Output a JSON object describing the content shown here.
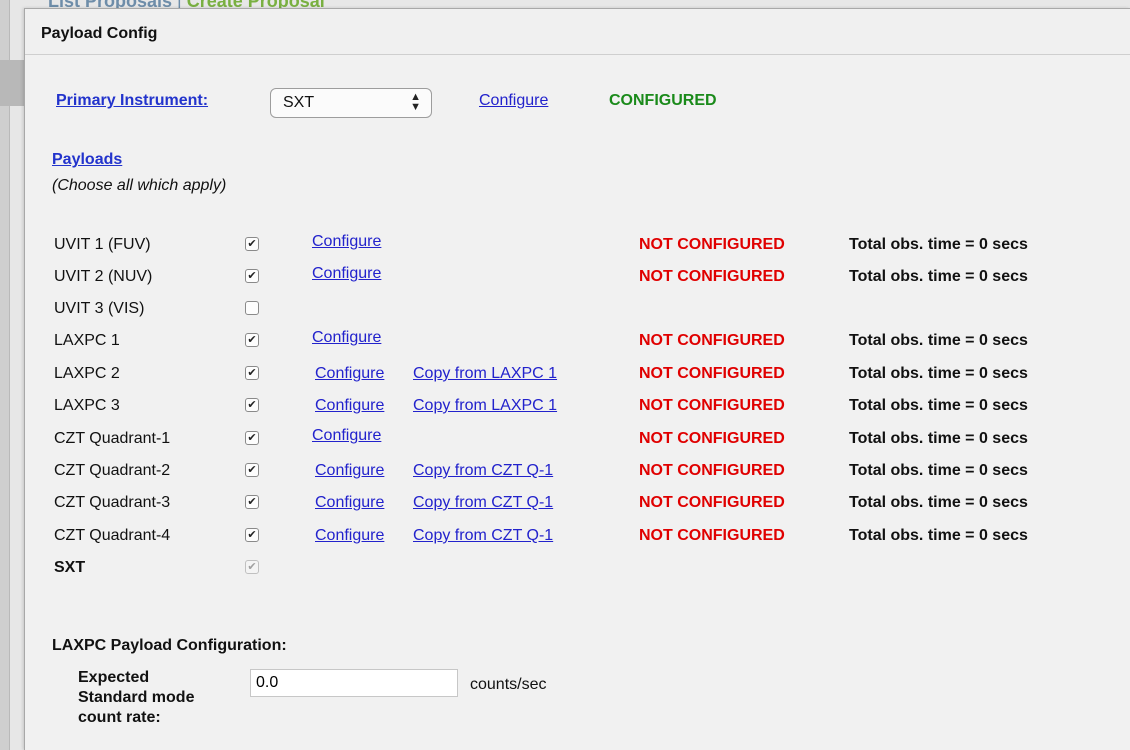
{
  "background": {
    "nav_list_proposals": "List Proposals",
    "nav_separator": "|",
    "nav_create_proposal": "Create Proposal"
  },
  "dialog": {
    "title": "Payload Config"
  },
  "primary": {
    "label": "Primary Instrument:",
    "selected": "SXT",
    "configure": "Configure",
    "status": "CONFIGURED"
  },
  "payloads": {
    "title": "Payloads",
    "hint": "(Choose all which apply)",
    "rows": [
      {
        "name": "UVIT 1 (FUV)",
        "checked": true,
        "configure": "Configure",
        "copy": "",
        "status": "NOT CONFIGURED",
        "total": "Total obs. time = 0 secs"
      },
      {
        "name": "UVIT 2 (NUV)",
        "checked": true,
        "configure": "Configure",
        "copy": "",
        "status": "NOT CONFIGURED",
        "total": "Total obs. time = 0 secs"
      },
      {
        "name": "UVIT 3 (VIS)",
        "checked": false,
        "configure": "",
        "copy": "",
        "status": "",
        "total": ""
      },
      {
        "name": "LAXPC 1",
        "checked": true,
        "configure": "Configure",
        "copy": "",
        "status": "NOT CONFIGURED",
        "total": "Total obs. time = 0 secs"
      },
      {
        "name": "LAXPC 2",
        "checked": true,
        "configure": "Configure",
        "copy": "Copy from LAXPC 1",
        "status": "NOT CONFIGURED",
        "total": "Total obs. time = 0 secs"
      },
      {
        "name": "LAXPC 3",
        "checked": true,
        "configure": "Configure",
        "copy": "Copy from LAXPC 1",
        "status": "NOT CONFIGURED",
        "total": "Total obs. time = 0 secs"
      },
      {
        "name": "CZT Quadrant-1",
        "checked": true,
        "configure": "Configure",
        "copy": "",
        "status": "NOT CONFIGURED",
        "total": "Total obs. time = 0 secs"
      },
      {
        "name": "CZT Quadrant-2",
        "checked": true,
        "configure": "Configure",
        "copy": "Copy from CZT Q-1",
        "status": "NOT CONFIGURED",
        "total": "Total obs. time = 0 secs"
      },
      {
        "name": "CZT Quadrant-3",
        "checked": true,
        "configure": "Configure",
        "copy": "Copy from CZT Q-1",
        "status": "NOT CONFIGURED",
        "total": "Total obs. time = 0 secs"
      },
      {
        "name": "CZT Quadrant-4",
        "checked": true,
        "configure": "Configure",
        "copy": "Copy from CZT Q-1",
        "status": "NOT CONFIGURED",
        "total": "Total obs. time = 0 secs"
      },
      {
        "name": "SXT",
        "checked": true,
        "disabled": true,
        "bold": true,
        "configure": "",
        "copy": "",
        "status": "",
        "total": ""
      }
    ]
  },
  "laxpc": {
    "heading": "LAXPC Payload Configuration:",
    "field_label_line1": "Expected",
    "field_label_line2": "Standard mode",
    "field_label_line3": "count rate:",
    "field_value": "0.0",
    "unit": "counts/sec"
  },
  "colors": {
    "configured": "#1a8a1a",
    "not_configured": "#e00000",
    "link": "#2222cc"
  }
}
